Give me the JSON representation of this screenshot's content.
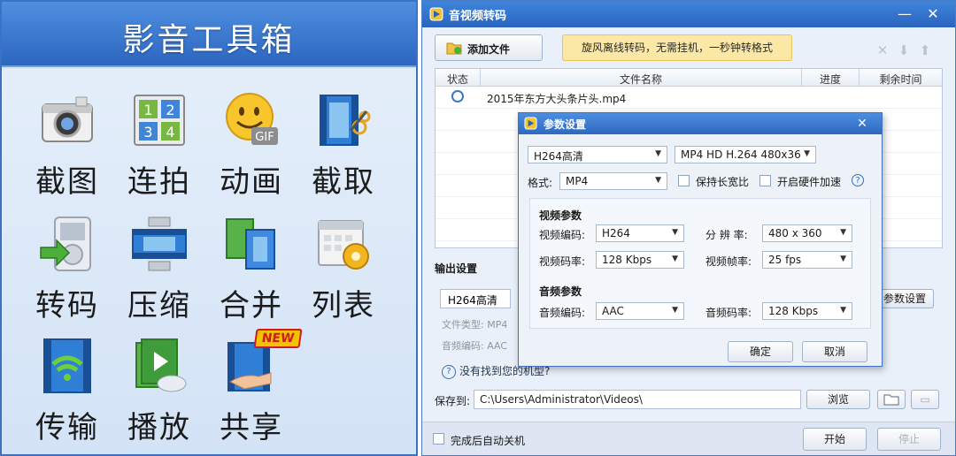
{
  "toolbox": {
    "title": "影音工具箱",
    "tools": [
      {
        "label": "截图",
        "icon": "camera-icon"
      },
      {
        "label": "连拍",
        "icon": "grid-numbers-icon"
      },
      {
        "label": "动画",
        "icon": "smiley-gif-icon"
      },
      {
        "label": "截取",
        "icon": "film-scissors-icon"
      },
      {
        "label": "转码",
        "icon": "player-arrow-icon"
      },
      {
        "label": "压缩",
        "icon": "film-compress-icon"
      },
      {
        "label": "合并",
        "icon": "film-merge-icon"
      },
      {
        "label": "列表",
        "icon": "calendar-gear-icon"
      },
      {
        "label": "传输",
        "icon": "film-wifi-icon"
      },
      {
        "label": "播放",
        "icon": "film-play-cloud-icon"
      },
      {
        "label": "共享",
        "icon": "film-hand-icon",
        "badge": "NEW"
      }
    ]
  },
  "window": {
    "title": "音视频转码",
    "add_file": "添加文件",
    "promo": "旋风离线转码，无需挂机，一秒钟转格式",
    "columns": [
      "状态",
      "文件名称",
      "进度",
      "剩余时间"
    ],
    "files": [
      {
        "name": "2015年东方大头条片头.mp4"
      }
    ],
    "output_settings_label": "输出设置",
    "output_profile": "H264高清",
    "file_type_label": "文件类型: MP4",
    "audio_codec_label": "音频编码: AAC",
    "param_settings_button": "参数设置",
    "missing_device_link": "没有找到您的机型?",
    "save_to_label": "保存到:",
    "save_path": "C:\\Users\\Administrator\\Videos\\",
    "browse_button": "浏览",
    "auto_shutdown_label": "完成后自动关机",
    "start_button": "开始",
    "stop_button": "停止"
  },
  "dialog": {
    "title": "参数设置",
    "preset_quality": "H264高清",
    "preset_device": "MP4 HD H.264 480x360",
    "format_label": "格式:",
    "format_value": "MP4",
    "keep_aspect_label": "保持长宽比",
    "hw_accel_label": "开启硬件加速",
    "video_section": "视频参数",
    "video_codec_label": "视频编码:",
    "video_codec_value": "H264",
    "resolution_label": "分 辨 率:",
    "resolution_value": "480 x 360",
    "video_bitrate_label": "视频码率:",
    "video_bitrate_value": "128 Kbps",
    "frame_rate_label": "视频帧率:",
    "frame_rate_value": "25 fps",
    "audio_section": "音频参数",
    "audio_codec_label": "音频编码:",
    "audio_codec_value": "AAC",
    "audio_bitrate_label": "音频码率:",
    "audio_bitrate_value": "128 Kbps",
    "ok_button": "确定",
    "cancel_button": "取消"
  },
  "colors": {
    "title_blue": "#2c66c0",
    "panel_bg": "#d7e6f7",
    "promo_bg": "#fbe7a6",
    "new_badge": "#f2c200"
  }
}
